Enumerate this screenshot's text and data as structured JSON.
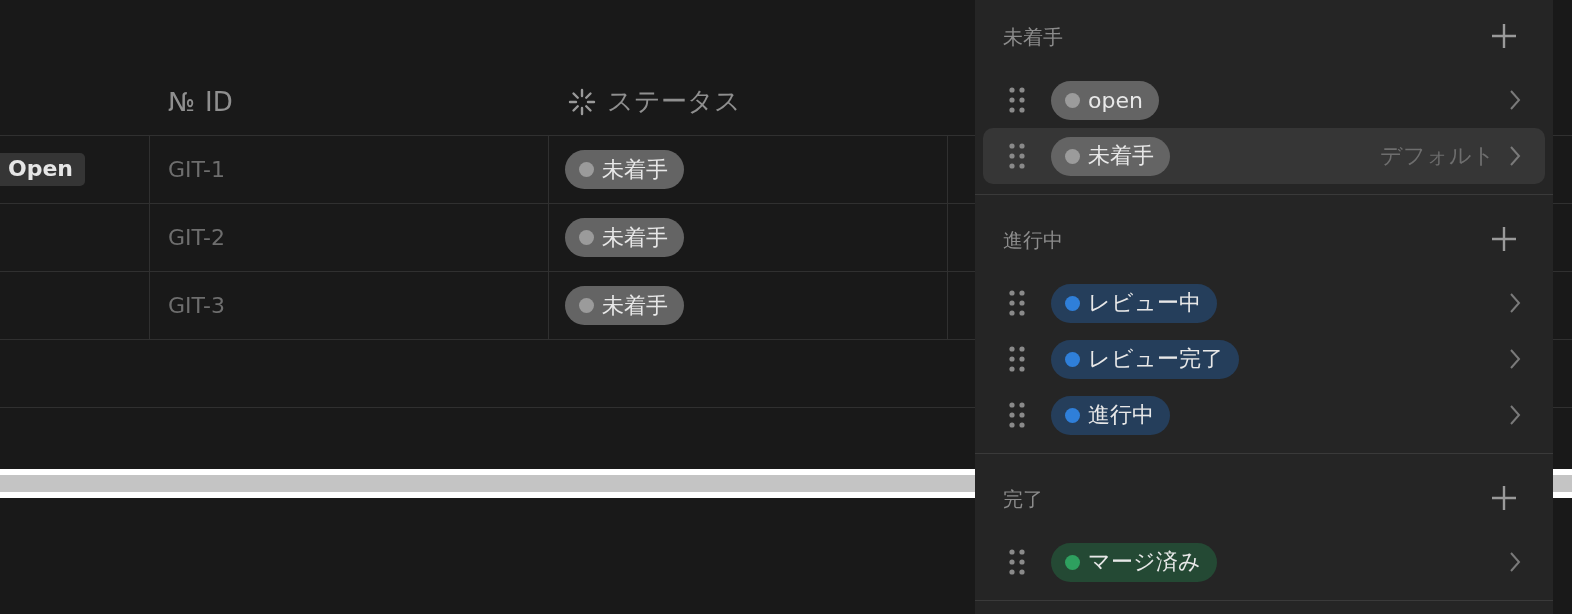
{
  "table": {
    "columns": [
      {
        "kind": "blank"
      },
      {
        "kind": "number",
        "icon_text": "№",
        "label": "ID"
      },
      {
        "kind": "status",
        "label": "ステータス"
      }
    ],
    "rows": [
      {
        "tag": "Open",
        "id": "GIT-1",
        "status": {
          "label": "未着手",
          "color": "#9b9b9b"
        }
      },
      {
        "id": "GIT-2",
        "status": {
          "label": "未着手",
          "color": "#9b9b9b"
        }
      },
      {
        "id": "GIT-3",
        "status": {
          "label": "未着手",
          "color": "#9b9b9b"
        }
      }
    ]
  },
  "status_panel": {
    "groups": [
      {
        "title": "未着手",
        "options": [
          {
            "label": "open",
            "color": "#9b9b9b",
            "highlighted": false
          },
          {
            "label": "未着手",
            "color": "#9b9b9b",
            "highlighted": true,
            "note": "デフォルト"
          }
        ]
      },
      {
        "title": "進行中",
        "options": [
          {
            "label": "レビュー中",
            "color": "#2f7fd9",
            "highlighted": false
          },
          {
            "label": "レビュー完了",
            "color": "#2f7fd9",
            "highlighted": false
          },
          {
            "label": "進行中",
            "color": "#2f7fd9",
            "highlighted": false
          }
        ]
      },
      {
        "title": "完了",
        "options": [
          {
            "label": "マージ済み",
            "color": "#2ea05f",
            "highlighted": false
          }
        ]
      }
    ]
  }
}
